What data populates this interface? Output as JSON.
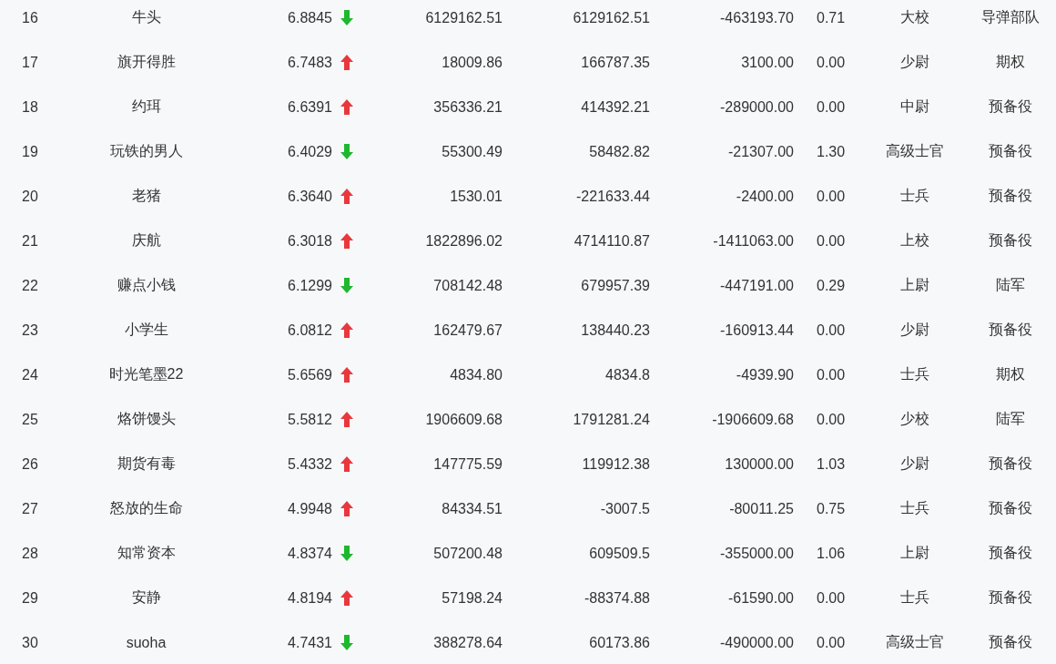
{
  "rows": [
    {
      "rank": "16",
      "name": "牛头",
      "score": "6.8845",
      "kind": "down",
      "column_5": "6129162.51",
      "column_6": "6129162.51",
      "column_7": "-463193.70",
      "column_8": "0.71",
      "column_9": "大校",
      "column_10": "导弹部队"
    },
    {
      "rank": "17",
      "name": "旗开得胜",
      "score": "6.7483",
      "kind": "up",
      "column_5": "18009.86",
      "column_6": "166787.35",
      "column_7": "3100.00",
      "column_8": "0.00",
      "column_9": "少尉",
      "column_10": "期权"
    },
    {
      "rank": "18",
      "name": "约珥",
      "score": "6.6391",
      "kind": "up",
      "column_5": "356336.21",
      "column_6": "414392.21",
      "column_7": "-289000.00",
      "column_8": "0.00",
      "column_9": "中尉",
      "column_10": "预备役"
    },
    {
      "rank": "19",
      "name": "玩铁的男人",
      "score": "6.4029",
      "kind": "down",
      "column_5": "55300.49",
      "column_6": "58482.82",
      "column_7": "-21307.00",
      "column_8": "1.30",
      "column_9": "高级士官",
      "column_10": "预备役"
    },
    {
      "rank": "20",
      "name": "老猪",
      "score": "6.3640",
      "kind": "up",
      "column_5": "1530.01",
      "column_6": "-221633.44",
      "column_7": "-2400.00",
      "column_8": "0.00",
      "column_9": "士兵",
      "column_10": "预备役"
    },
    {
      "rank": "21",
      "name": "庆航",
      "score": "6.3018",
      "kind": "up",
      "column_5": "1822896.02",
      "column_6": "4714110.87",
      "column_7": "-1411063.00",
      "column_8": "0.00",
      "column_9": "上校",
      "column_10": "预备役"
    },
    {
      "rank": "22",
      "name": "赚点小钱",
      "score": "6.1299",
      "kind": "down",
      "column_5": "708142.48",
      "column_6": "679957.39",
      "column_7": "-447191.00",
      "column_8": "0.29",
      "column_9": "上尉",
      "column_10": "陆军"
    },
    {
      "rank": "23",
      "name": "小学生",
      "score": "6.0812",
      "kind": "up",
      "column_5": "162479.67",
      "column_6": "138440.23",
      "column_7": "-160913.44",
      "column_8": "0.00",
      "column_9": "少尉",
      "column_10": "预备役"
    },
    {
      "rank": "24",
      "name": "时光笔墨22",
      "score": "5.6569",
      "kind": "up",
      "column_5": "4834.80",
      "column_6": "4834.8",
      "column_7": "-4939.90",
      "column_8": "0.00",
      "column_9": "士兵",
      "column_10": "期权"
    },
    {
      "rank": "25",
      "name": "烙饼馒头",
      "score": "5.5812",
      "kind": "up",
      "column_5": "1906609.68",
      "column_6": "1791281.24",
      "column_7": "-1906609.68",
      "column_8": "0.00",
      "column_9": "少校",
      "column_10": "陆军"
    },
    {
      "rank": "26",
      "name": "期货有毒",
      "score": "5.4332",
      "kind": "up",
      "column_5": "147775.59",
      "column_6": "119912.38",
      "column_7": "130000.00",
      "column_8": "1.03",
      "column_9": "少尉",
      "column_10": "预备役"
    },
    {
      "rank": "27",
      "name": "怒放的生命",
      "score": "4.9948",
      "kind": "up",
      "column_5": "84334.51",
      "column_6": "-3007.5",
      "column_7": "-80011.25",
      "column_8": "0.75",
      "column_9": "士兵",
      "column_10": "预备役"
    },
    {
      "rank": "28",
      "name": "知常资本",
      "score": "4.8374",
      "kind": "down",
      "column_5": "507200.48",
      "column_6": "609509.5",
      "column_7": "-355000.00",
      "column_8": "1.06",
      "column_9": "上尉",
      "column_10": "预备役"
    },
    {
      "rank": "29",
      "name": "安静",
      "score": "4.8194",
      "kind": "up",
      "column_5": "57198.24",
      "column_6": "-88374.88",
      "column_7": "-61590.00",
      "column_8": "0.00",
      "column_9": "士兵",
      "column_10": "预备役"
    },
    {
      "rank": "30",
      "name": "suoha",
      "score": "4.7431",
      "kind": "down",
      "column_5": "388278.64",
      "column_6": "60173.86",
      "column_7": "-490000.00",
      "column_8": "0.00",
      "column_9": "高级士官",
      "column_10": "预备役"
    }
  ]
}
